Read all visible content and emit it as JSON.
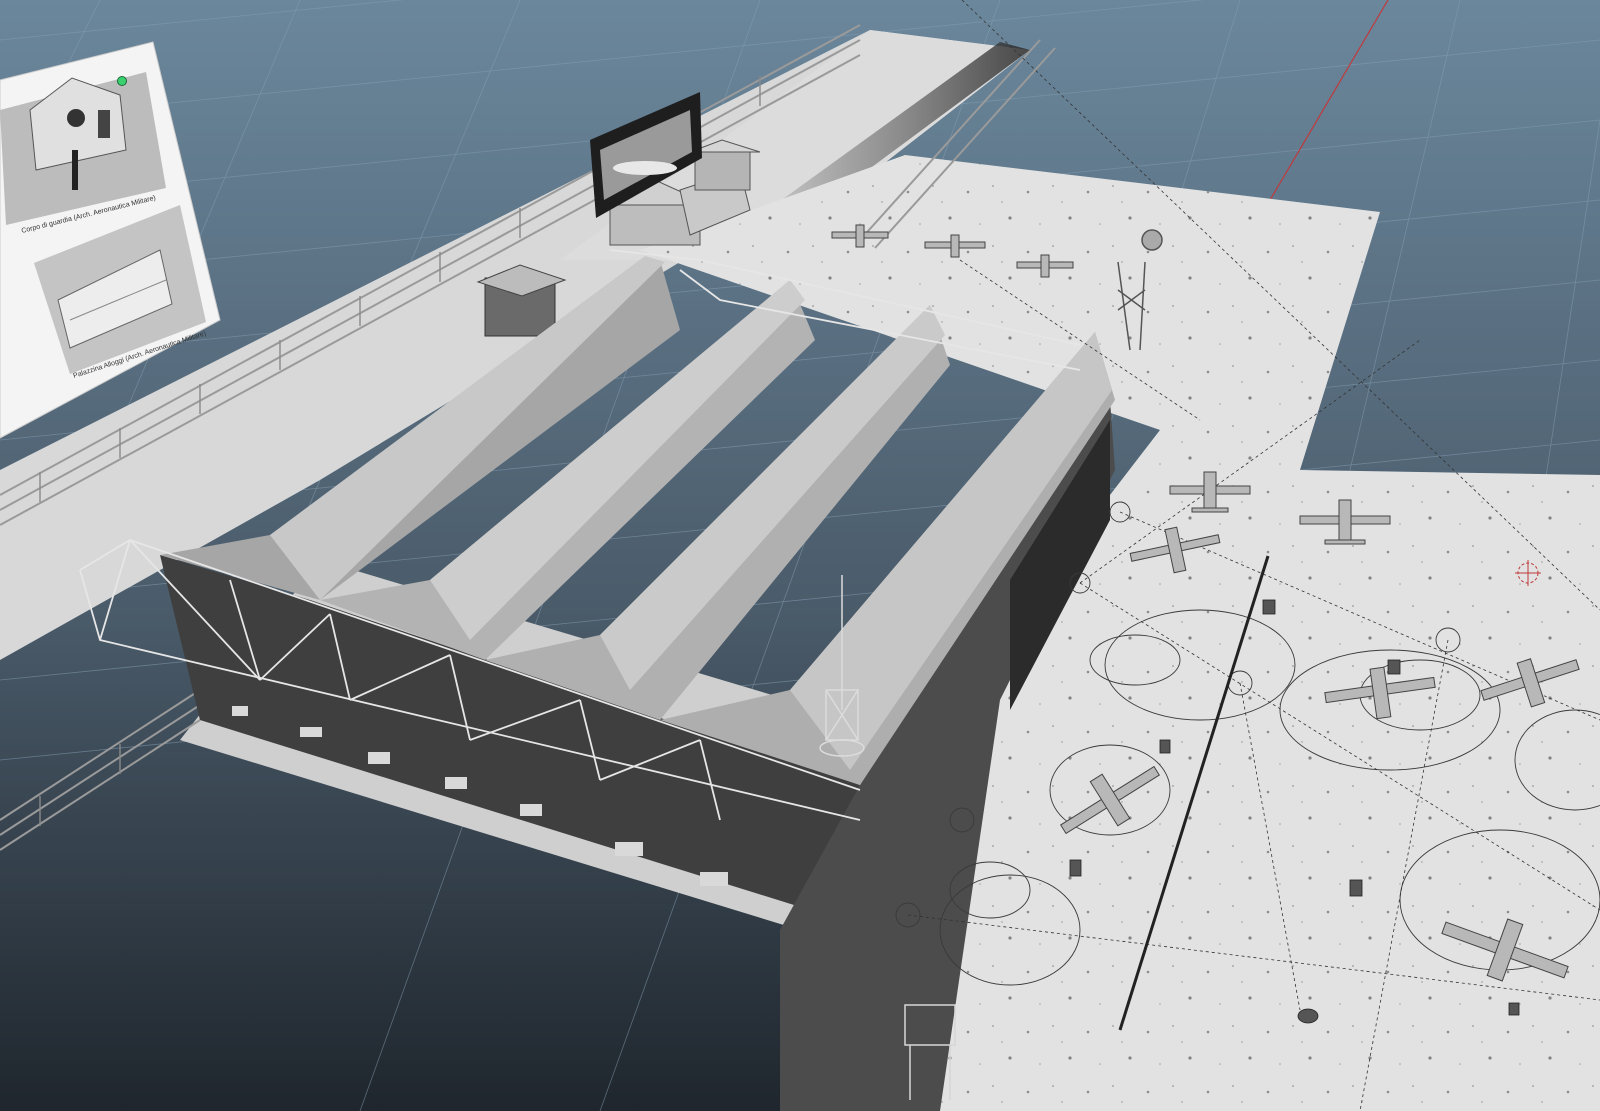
{
  "viewport": {
    "colors": {
      "sky_top": "#6f8aa0",
      "sky_bottom": "#1e252c",
      "grid": "#7f97aa",
      "ground": "#d9d9d9",
      "roof_light": "#bdbdbd",
      "roof_dark": "#8f8f8f",
      "wall": "#3d3d3d",
      "accent_dot": "#3bd16f",
      "axis_red": "#c0393b"
    }
  },
  "reference_board": {
    "photo_top_caption": "Corpo di guardia (Arch. Aeronautica Militare)",
    "photo_bottom_caption": "Palazzina Alloggi (Arch. Aeronautica Militare)"
  }
}
